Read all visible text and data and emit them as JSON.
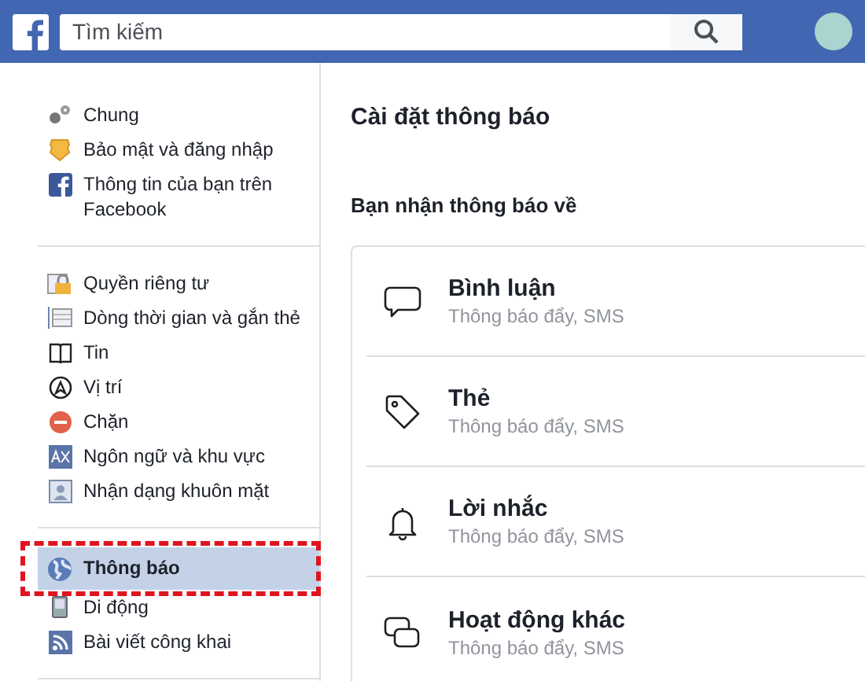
{
  "top_bar": {
    "search": {
      "placeholder": "Tìm kiếm"
    }
  },
  "sidebar": {
    "groups": [
      {
        "items": [
          {
            "kind": "general",
            "label": "Chung",
            "selected": false,
            "highlighted": false
          },
          {
            "kind": "security",
            "label": "Bảo mật và đăng nhập",
            "selected": false,
            "highlighted": false
          },
          {
            "kind": "facebook",
            "label": "Thông tin của bạn trên Facebook",
            "selected": false,
            "highlighted": false
          }
        ]
      },
      {
        "items": [
          {
            "kind": "privacy",
            "label": "Quyền riêng tư",
            "selected": false,
            "highlighted": false
          },
          {
            "kind": "timeline",
            "label": "Dòng thời gian và gắn thẻ",
            "selected": false,
            "highlighted": false
          },
          {
            "kind": "stories",
            "label": "Tin",
            "selected": false,
            "highlighted": false
          },
          {
            "kind": "location",
            "label": "Vị trí",
            "selected": false,
            "highlighted": false
          },
          {
            "kind": "blocking",
            "label": "Chặn",
            "selected": false,
            "highlighted": false
          },
          {
            "kind": "language",
            "label": "Ngôn ngữ và khu vực",
            "selected": false,
            "highlighted": false
          },
          {
            "kind": "face",
            "label": "Nhận dạng khuôn mặt",
            "selected": false,
            "highlighted": false
          }
        ]
      },
      {
        "items": [
          {
            "kind": "notifications",
            "label": "Thông báo",
            "selected": true,
            "highlighted": true
          },
          {
            "kind": "mobile",
            "label": "Di động",
            "selected": false,
            "highlighted": false
          },
          {
            "kind": "posts",
            "label": "Bài viết công khai",
            "selected": false,
            "highlighted": false
          }
        ]
      }
    ]
  },
  "main": {
    "title": "Cài đặt thông báo",
    "section_title": "Bạn nhận thông báo về",
    "rows": [
      {
        "kind": "comment",
        "title": "Bình luận",
        "subtitle": "Thông báo đẩy, SMS"
      },
      {
        "kind": "tag",
        "title": "Thẻ",
        "subtitle": "Thông báo đẩy, SMS"
      },
      {
        "kind": "reminder",
        "title": "Lời nhắc",
        "subtitle": "Thông báo đẩy, SMS"
      },
      {
        "kind": "activity",
        "title": "Hoạt động khác",
        "subtitle": "Thông báo đẩy, SMS"
      }
    ]
  }
}
